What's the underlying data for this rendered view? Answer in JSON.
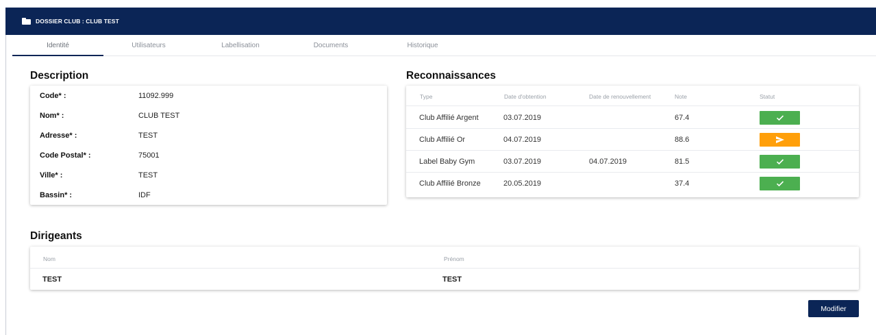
{
  "header": {
    "title": "DOSSIER CLUB : CLUB TEST",
    "icon": "folder-icon"
  },
  "tabs": [
    {
      "label": "Identité",
      "active": true
    },
    {
      "label": "Utilisateurs",
      "active": false
    },
    {
      "label": "Labellisation",
      "active": false
    },
    {
      "label": "Documents",
      "active": false
    },
    {
      "label": "Historique",
      "active": false
    }
  ],
  "description": {
    "title": "Description",
    "fields": [
      {
        "label": "Code* :",
        "value": "11092.999"
      },
      {
        "label": "Nom* :",
        "value": "CLUB TEST"
      },
      {
        "label": "Adresse* :",
        "value": "TEST"
      },
      {
        "label": "Code Postal* :",
        "value": "75001"
      },
      {
        "label": "Ville* :",
        "value": "TEST"
      },
      {
        "label": "Bassin* :",
        "value": "IDF"
      }
    ]
  },
  "reconnaissances": {
    "title": "Reconnaissances",
    "columns": {
      "type": "Type",
      "obtention": "Date d'obtention",
      "renouvellement": "Date de renouvellement",
      "note": "Note",
      "statut": "Statut"
    },
    "rows": [
      {
        "type": "Club Affilié Argent",
        "obtention": "03.07.2019",
        "renouvellement": "",
        "note": "67.4",
        "status": "validated",
        "status_icon": "check-icon"
      },
      {
        "type": "Club Affilié Or",
        "obtention": "04.07.2019",
        "renouvellement": "",
        "note": "88.6",
        "status": "sent",
        "status_icon": "send-icon"
      },
      {
        "type": "Label Baby Gym",
        "obtention": "03.07.2019",
        "renouvellement": "04.07.2019",
        "note": "81.5",
        "status": "validated",
        "status_icon": "check-icon"
      },
      {
        "type": "Club Affilié Bronze",
        "obtention": "20.05.2019",
        "renouvellement": "",
        "note": "37.4",
        "status": "validated",
        "status_icon": "check-icon"
      }
    ]
  },
  "dirigeants": {
    "title": "Dirigeants",
    "columns": {
      "nom": "Nom",
      "prenom": "Prénom"
    },
    "rows": [
      {
        "nom": "TEST",
        "prenom": "TEST"
      }
    ]
  },
  "actions": {
    "modifier_label": "Modifier"
  },
  "colors": {
    "primary": "#0b2556",
    "success": "#4caf50",
    "warning": "#ff9f0a"
  }
}
